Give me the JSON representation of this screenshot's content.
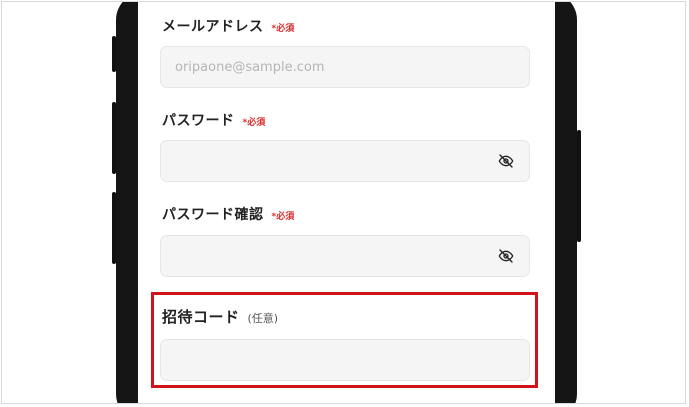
{
  "form": {
    "email": {
      "label": "メールアドレス",
      "required": "*必須",
      "placeholder": "oripaone@sample.com",
      "value": ""
    },
    "password": {
      "label": "パスワード",
      "required": "*必須",
      "value": "",
      "toggle_icon": "eye-off-icon"
    },
    "password_confirm": {
      "label": "パスワード確認",
      "required": "*必須",
      "value": "",
      "toggle_icon": "eye-off-icon"
    },
    "invite_code": {
      "label": "招待コード",
      "optional": "(任意)",
      "value": ""
    }
  },
  "colors": {
    "required_text": "#e02b2b",
    "highlight_border": "#d0121b",
    "field_bg": "#f5f5f5"
  }
}
